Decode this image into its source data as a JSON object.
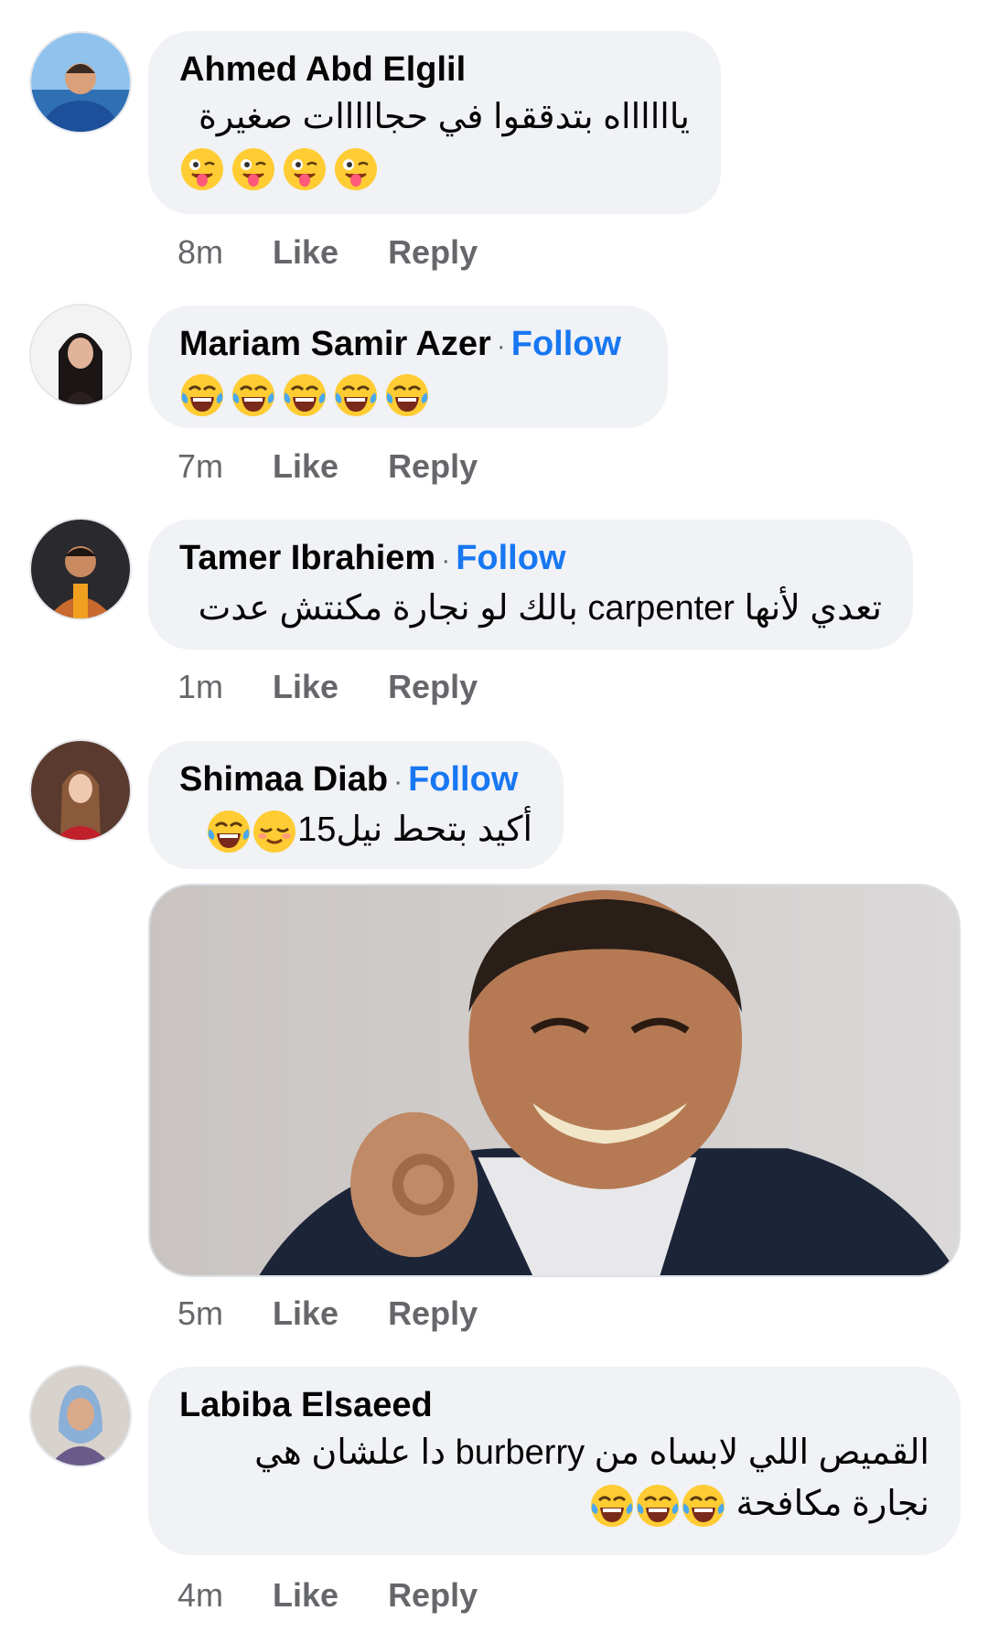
{
  "comments": [
    {
      "author": "Ahmed Abd Elglil",
      "follow": "",
      "text": "يااااااه بتدققوا في حجااااات صغيرة",
      "time": "8m",
      "like": "Like",
      "reply": "Reply",
      "emojis": [
        "winking-tongue-face",
        "winking-tongue-face",
        "winking-tongue-face",
        "winking-tongue-face"
      ]
    },
    {
      "author": "Mariam Samir Azer",
      "follow": "Follow",
      "time": "7m",
      "like": "Like",
      "reply": "Reply",
      "emojis": [
        "tears-of-joy-face",
        "tears-of-joy-face",
        "tears-of-joy-face",
        "tears-of-joy-face",
        "tears-of-joy-face"
      ]
    },
    {
      "author": "Tamer Ibrahiem",
      "follow": "Follow",
      "text": "تعدي لأنها carpenter بالك لو نجارة مكنتش عدت",
      "time": "1m",
      "like": "Like",
      "reply": "Reply"
    },
    {
      "author": "Shimaa Diab",
      "follow": "Follow",
      "text": "أكيد بتحط نيل15",
      "time": "5m",
      "like": "Like",
      "reply": "Reply",
      "emojis": [
        "relieved-face",
        "tears-of-joy-face"
      ]
    },
    {
      "author": "Labiba Elsaeed",
      "follow": "",
      "text_line1": "القميص اللي لابساه من burberry  دا علشان هي",
      "text_line2": "نجارة مكافحة",
      "time": "4m",
      "like": "Like",
      "reply": "Reply",
      "emojis": [
        "tears-of-joy-face",
        "tears-of-joy-face",
        "tears-of-joy-face"
      ]
    }
  ],
  "colors": {
    "bubble": "#f0f2f5",
    "follow": "#1877f2",
    "meta": "#65676b"
  }
}
